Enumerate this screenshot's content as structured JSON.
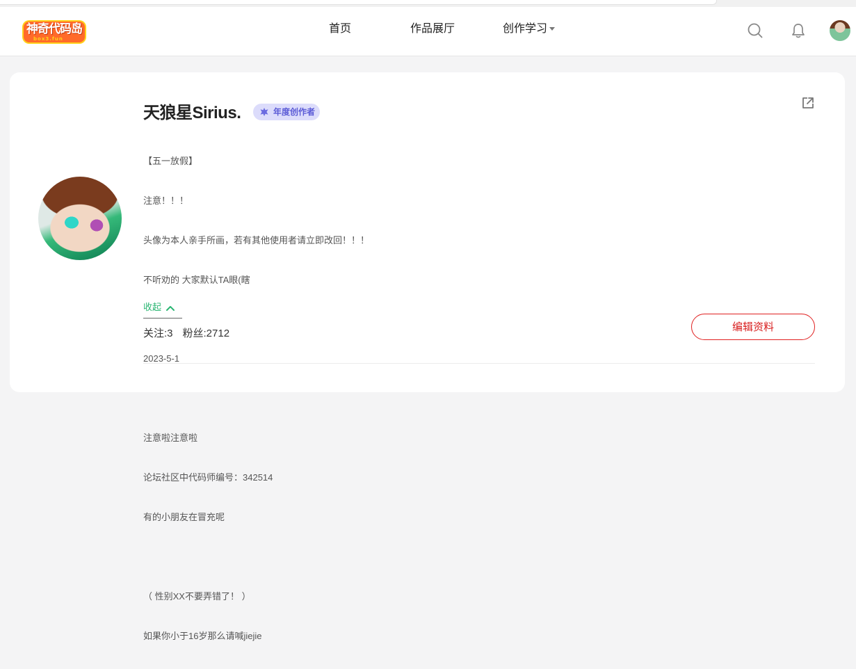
{
  "header": {
    "logo_text": "神奇代码岛",
    "logo_sub": "box3.fun",
    "nav": {
      "home": "首页",
      "works": "作品展厅",
      "learn": "创作学习"
    }
  },
  "profile": {
    "name": "天狼星Sirius.",
    "badge": "年度创作者",
    "bio_lines": [
      "【五一放假】",
      "注意！！！",
      "头像为本人亲手所画，若有其他使用者请立即改回！！！",
      "不听劝的 大家默认TA眼(瞎",
      "2023-5-1",
      "",
      "注意啦注意啦",
      "论坛社区中代码师编号：342514",
      "有的小朋友在冒充呢",
      "",
      "（ 性别XX不要弄错了！ ）",
      "如果你小于16岁那么请喊jiejie"
    ],
    "collapse_label": "收起",
    "following": "关注:3",
    "followers": "粉丝:2712",
    "edit_button": "编辑资料"
  },
  "icons": {
    "search": "search-icon",
    "bell": "bell-icon",
    "external": "external-link-icon",
    "badge": "crown-icon"
  },
  "colors": {
    "accent_red": "#d81e1e",
    "collapse_green": "#2bb673",
    "badge_bg": "#dcdcfb",
    "badge_text": "#5b5bd6"
  }
}
